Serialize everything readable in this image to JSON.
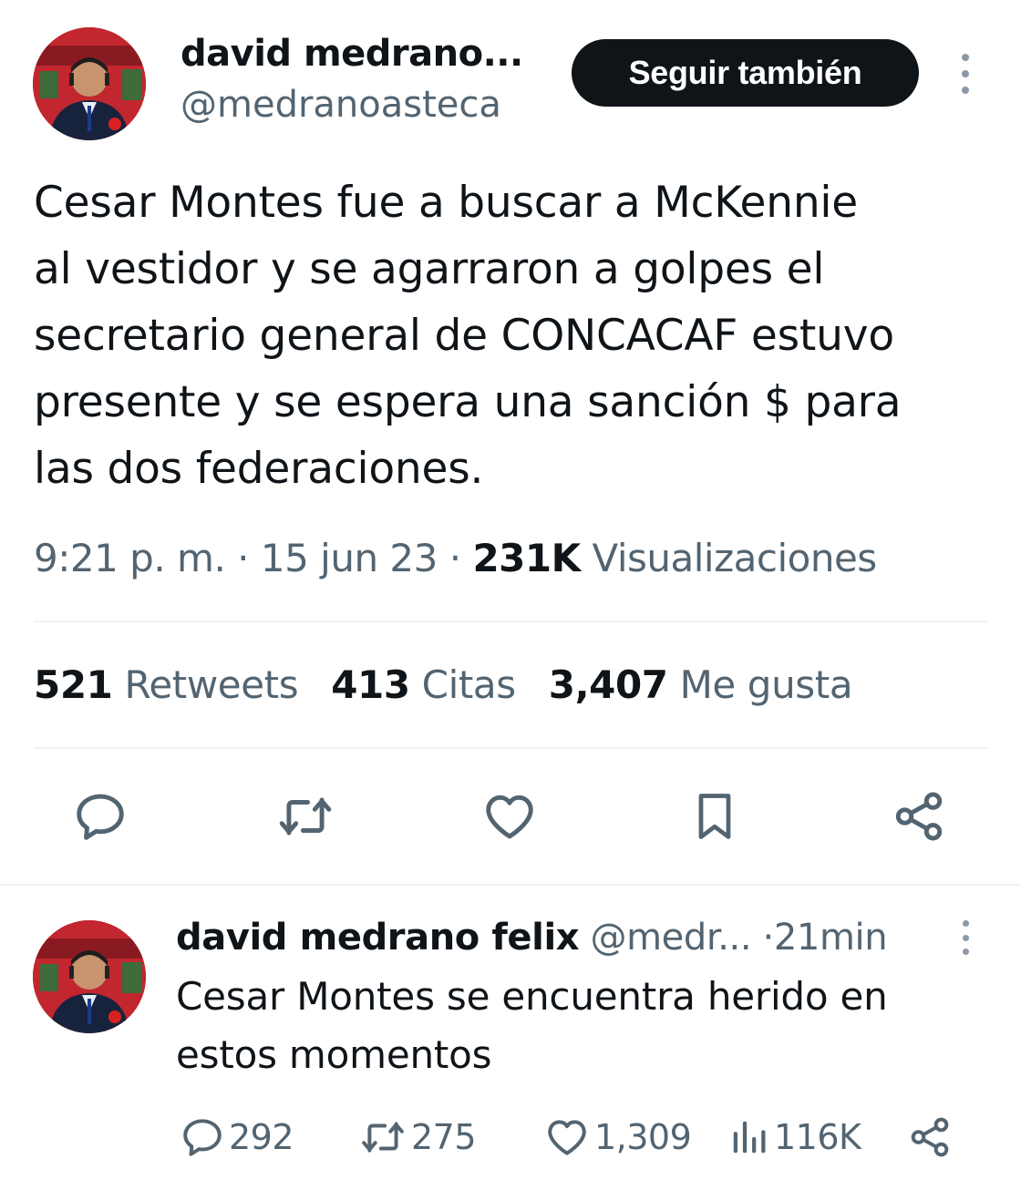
{
  "main_tweet": {
    "author_name": "david medrano...",
    "author_handle": "@medranoasteca",
    "follow_label": "Seguir también",
    "text": "Cesar Montes fue a buscar a McKennie\nal vestidor y se agarraron a golpes el\nsecretario general de CONCACAF estuvo\npresente y se espera una sanción $ para\nlas dos federaciones.",
    "time": "9:21 p. m.",
    "date": "15 jun 23",
    "separator": "·",
    "views_count": "231K",
    "views_label": "Visualizaciones",
    "stats": {
      "retweets_count": "521",
      "retweets_label": "Retweets",
      "quotes_count": "413",
      "quotes_label": "Citas",
      "likes_count": "3,407",
      "likes_label": "Me gusta"
    },
    "actions": [
      "reply-icon",
      "retweet-icon",
      "like-icon",
      "bookmark-icon",
      "share-icon"
    ]
  },
  "reply_tweet": {
    "author_name": "david medrano felix",
    "author_handle": "@medr...",
    "time_sep": "·",
    "time": "21min",
    "text": "Cesar Montes se encuentra herido en\nestos momentos",
    "replies": "292",
    "retweets": "275",
    "likes": "1,309",
    "views": "116K"
  },
  "colors": {
    "text": "#0f1419",
    "secondary": "#536471",
    "divider": "#eff3f4",
    "button_bg": "#0f1419",
    "button_text": "#ffffff"
  }
}
